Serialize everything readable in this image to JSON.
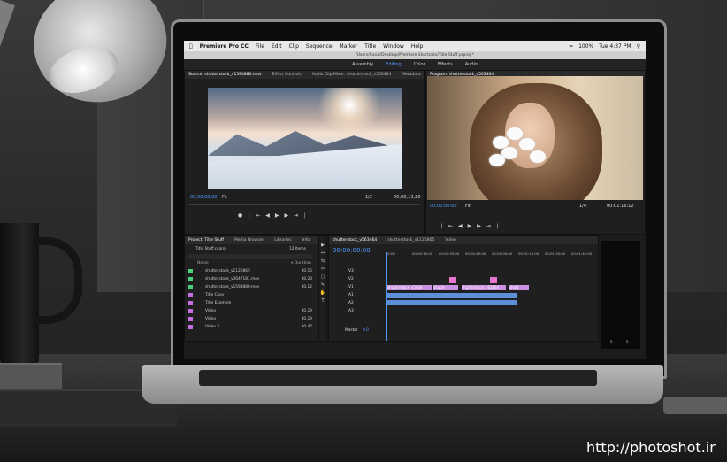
{
  "watermark": "http://photoshot.ir",
  "mac_menu": {
    "app": "Premiere Pro CC",
    "items": [
      "File",
      "Edit",
      "Clip",
      "Sequence",
      "Marker",
      "Title",
      "Window",
      "Help"
    ],
    "battery": "100%",
    "clock": "Tue 4:37 PM"
  },
  "window_path": "/Users/Cassi/Desktop/Premiere Shortcuts/Title Stuff.prproj *",
  "workspaces": {
    "items": [
      "Assembly",
      "Editing",
      "Color",
      "Effects",
      "Audio"
    ],
    "active": "Editing"
  },
  "source_panel": {
    "tabs": [
      "Source: shutterstock_v1594880.mov",
      "Effect Controls",
      "Audio Clip Mixer: shutterstock_v563464",
      "Metadata"
    ],
    "timecode": "00;00;00;00",
    "fit": "Fit",
    "ratio": "1/2",
    "duration": "00;00;13;20"
  },
  "program_panel": {
    "tab": "Program: shutterstock_v563464",
    "timecode": "00:00:00:00",
    "fit": "Fit",
    "ratio": "1/4",
    "duration": "00:01:16:12"
  },
  "project_panel": {
    "tabs": [
      "Project: Title Stuff",
      "Media Browser",
      "Libraries",
      "Info"
    ],
    "file": "Title Stuff.prproj",
    "count": "12 Items",
    "col_name": "Name",
    "col_rate": "e Duration",
    "rows": [
      {
        "name": "shutterstock_v1126865",
        "dur": "30.15",
        "color": "#4bd07a"
      },
      {
        "name": "shutterstock_v3647181.mov",
        "dur": "30.23",
        "color": "#4bd07a"
      },
      {
        "name": "shutterstock_v1594880.mov",
        "dur": "30.12",
        "color": "#4bd07a"
      },
      {
        "name": "Title Copy",
        "dur": "",
        "color": "#c86fe0"
      },
      {
        "name": "Title Example",
        "dur": "",
        "color": "#c86fe0"
      },
      {
        "name": "Video",
        "dur": "30.19",
        "color": "#c86fe0"
      },
      {
        "name": "Video",
        "dur": "30.19",
        "color": "#c86fe0"
      },
      {
        "name": "Video 2",
        "dur": "30.47",
        "color": "#c86fe0"
      }
    ]
  },
  "timeline": {
    "tabs": [
      "shutterstock_v563464",
      "shutterstock_v1126865",
      "Video"
    ],
    "timecode": "00:00:00:00",
    "ruler": [
      "00:00",
      "00:00:15:00",
      "00:00:30:00",
      "00:00:45:00",
      "00:01:00:00",
      "00:01:15:00",
      "00:01:30:00",
      "00:01:45:00"
    ],
    "tracks_v": [
      "V3",
      "V2",
      "V1"
    ],
    "tracks_a": [
      "A1",
      "A2",
      "A3"
    ],
    "clips": [
      "shutterstock_v5634",
      "shutte",
      "shutterstock_v42864",
      "shutt"
    ],
    "master_label": "Master",
    "master_value": "0.0"
  },
  "meter_labels": [
    "S",
    "S"
  ]
}
